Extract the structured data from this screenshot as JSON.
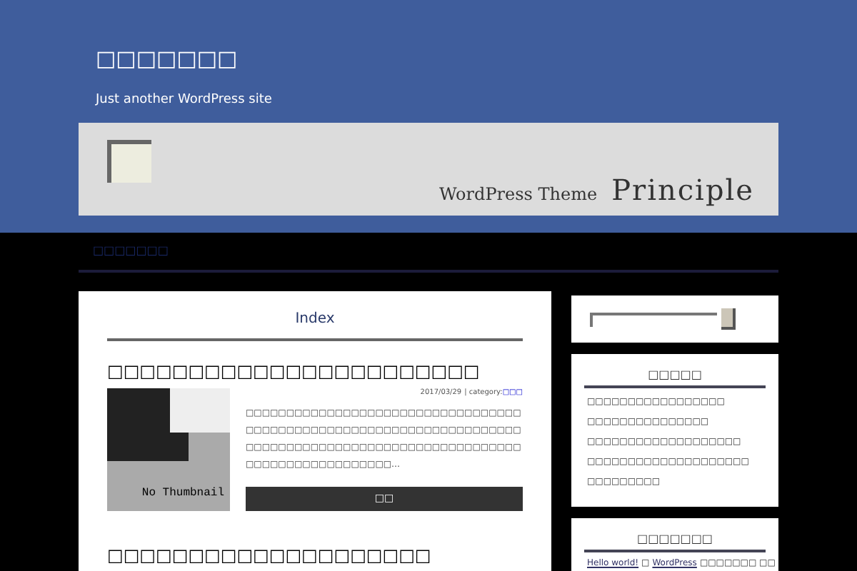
{
  "site": {
    "title": "□□□□□□□",
    "tagline": "Just another WordPress site"
  },
  "banner": {
    "subtitle": "WordPress Theme",
    "name": "Principle"
  },
  "nav": {
    "items": [
      "□□□□□□□"
    ]
  },
  "main": {
    "heading": "Index",
    "posts": [
      {
        "title": "□□□□□□□□□□□□□□□□□□□□□□□",
        "date": "2017/03/29",
        "category_label": "| category:",
        "category": "□□□",
        "thumbnail": "No Thumbnail",
        "excerpt": "□□□□□□□□□□□□□□□□□□□□□□□□□□□□□□□□□□□□□□□□□□□□□□□□□□□□□□□□□□□□□□□□□□□□□□□□□□□□□□□□□□□□□□□□□□□□□□□□□□□□□□□□□□□□□□□□□□□□□□□□…",
        "button": "□□"
      },
      {
        "title": "□□□□□□□□□□□□□□□□□□□□"
      }
    ]
  },
  "sidebar": {
    "widgets": [
      {
        "kind": "search"
      },
      {
        "kind": "list",
        "heading": "□□□□□",
        "items": [
          "□□□□□□□□□□□□□□□□□",
          "□□□□□□□□□□□□□□□",
          "□□□□□□□□□□□□□□□□□□□",
          "□□□□□□□□□□□□□□□□□□□□",
          "□□□□□□□□□"
        ]
      },
      {
        "kind": "comments",
        "heading": "□□□□□□□",
        "items": [
          {
            "author": "Hello world!",
            "sep": "□",
            "post": "WordPress",
            "rest": "□□□□□□□ □□"
          }
        ]
      }
    ]
  }
}
